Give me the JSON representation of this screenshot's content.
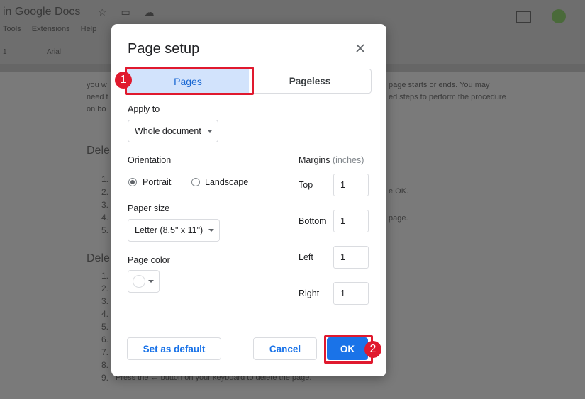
{
  "background": {
    "doc_title": "in Google Docs",
    "menu": [
      "Tools",
      "Extensions",
      "Help"
    ],
    "toolbar": {
      "font": "Arial",
      "size": "1"
    },
    "lines": [
      "you w",
      "need t",
      "on bo",
      "page starts or ends. You may",
      "ed steps to perform the procedure"
    ],
    "headings": [
      "Dele",
      "Dele"
    ],
    "numbers": [
      "1.",
      "2.",
      "3.",
      "4.",
      "5.",
      "1.",
      "2.",
      "3.",
      "4.",
      "5.",
      "6.",
      "7.",
      "8.",
      "9."
    ],
    "side_texts": [
      "e OK.",
      "page."
    ],
    "footer_line": "Press the ← button on your keyboard to delete the page."
  },
  "dialog": {
    "title": "Page setup",
    "close_icon": "close-icon",
    "tabs": [
      {
        "label": "Pages",
        "selected": true
      },
      {
        "label": "Pageless",
        "selected": false
      }
    ],
    "apply_to": {
      "label": "Apply to",
      "value": "Whole document"
    },
    "orientation": {
      "label": "Orientation",
      "options": [
        {
          "label": "Portrait",
          "selected": true
        },
        {
          "label": "Landscape",
          "selected": false
        }
      ]
    },
    "paper_size": {
      "label": "Paper size",
      "value": "Letter (8.5\" x 11\")"
    },
    "page_color": {
      "label": "Page color",
      "value": "#ffffff"
    },
    "margins": {
      "label": "Margins",
      "unit": "(inches)",
      "fields": [
        {
          "label": "Top",
          "value": "1"
        },
        {
          "label": "Bottom",
          "value": "1"
        },
        {
          "label": "Left",
          "value": "1"
        },
        {
          "label": "Right",
          "value": "1"
        }
      ]
    },
    "buttons": {
      "set_default": "Set as default",
      "cancel": "Cancel",
      "ok": "OK"
    }
  },
  "annotations": {
    "badge_1": "1",
    "badge_2": "2",
    "highlight_color": "#e0192e"
  }
}
